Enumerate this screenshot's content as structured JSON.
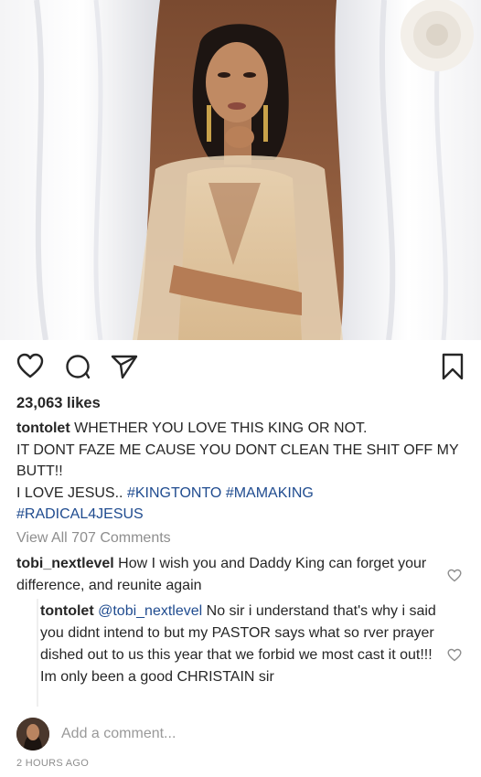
{
  "post": {
    "likes": "23,063 likes",
    "caption": {
      "username": "tontolet",
      "line1": "WHETHER YOU LOVE THIS KING OR NOT.",
      "line2": "IT DONT FAZE ME CAUSE YOU DONT CLEAN THE SHIT OFF MY BUTT!!",
      "line3": "I LOVE JESUS..",
      "hashtags": [
        "#KINGTONTO",
        "#MAMAKING",
        "#RADICAL4JESUS"
      ]
    },
    "view_all": "View All 707 Comments",
    "comments": [
      {
        "username": "tobi_nextlevel",
        "text": "How I wish you and Daddy King can forget your difference, and reunite again"
      }
    ],
    "reply": {
      "username": "tontolet",
      "mention": "@tobi_nextlevel",
      "text": "No sir i understand that's why i said you didnt intend to but my PASTOR says what so rver prayer dished out to us this year that we forbid we most cast it out!!! Im only been a good CHRISTAIN sir"
    },
    "add_comment_placeholder": "Add a comment...",
    "timestamp": "2 HOURS AGO"
  },
  "icons": {
    "like": "heart-icon",
    "comment": "comment-bubble-icon",
    "share": "paper-plane-icon",
    "save": "bookmark-icon",
    "comment_like": "small-heart-icon"
  }
}
